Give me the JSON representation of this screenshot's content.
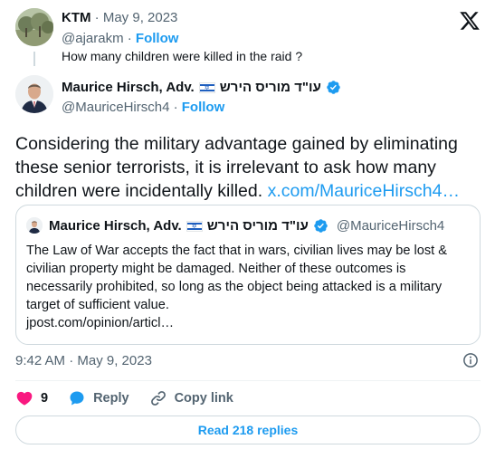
{
  "reply": {
    "name": "KTM",
    "separator": " · ",
    "date": "May 9, 2023",
    "handle": "@ajarakm",
    "follow_separator": " · ",
    "follow_label": "Follow",
    "text": "How many children were killed in the raid ?"
  },
  "tweet": {
    "name": "Maurice Hirsch, Adv.",
    "hebrew_name": "עו\"ד מוריס הירש",
    "handle": "@MauriceHirsch4",
    "follow_separator": " · ",
    "follow_label": "Follow",
    "text": "Considering the military advantage gained by eliminating these senior terrorists, it is irrelevant to ask how many children were incidentally killed. ",
    "link": "x.com/MauriceHirsch4…",
    "timestamp": "9:42 AM · May 9, 2023"
  },
  "quote": {
    "name": "Maurice Hirsch, Adv.",
    "hebrew_name": "עו\"ד מוריס הירש",
    "handle": "@MauriceHirsch4",
    "text": "The Law of War accepts the fact that in wars, civilian lives may be lost & civilian property might be damaged. Neither of these outcomes is necessarily prohibited, so long as the object being attacked is a military target of sufficient value.",
    "link": "jpost.com/opinion/articl…"
  },
  "actions": {
    "likes": "9",
    "reply_label": "Reply",
    "copy_link_label": "Copy link"
  },
  "read_replies_label": "Read 218 replies",
  "colors": {
    "accent": "#1d9bf0",
    "like": "#f91880",
    "muted": "#536471",
    "border": "#cfd9de"
  },
  "icons": [
    "x-logo-icon",
    "israel-flag-icon",
    "verified-badge-icon",
    "info-icon",
    "heart-icon",
    "reply-bubble-icon",
    "link-icon"
  ]
}
